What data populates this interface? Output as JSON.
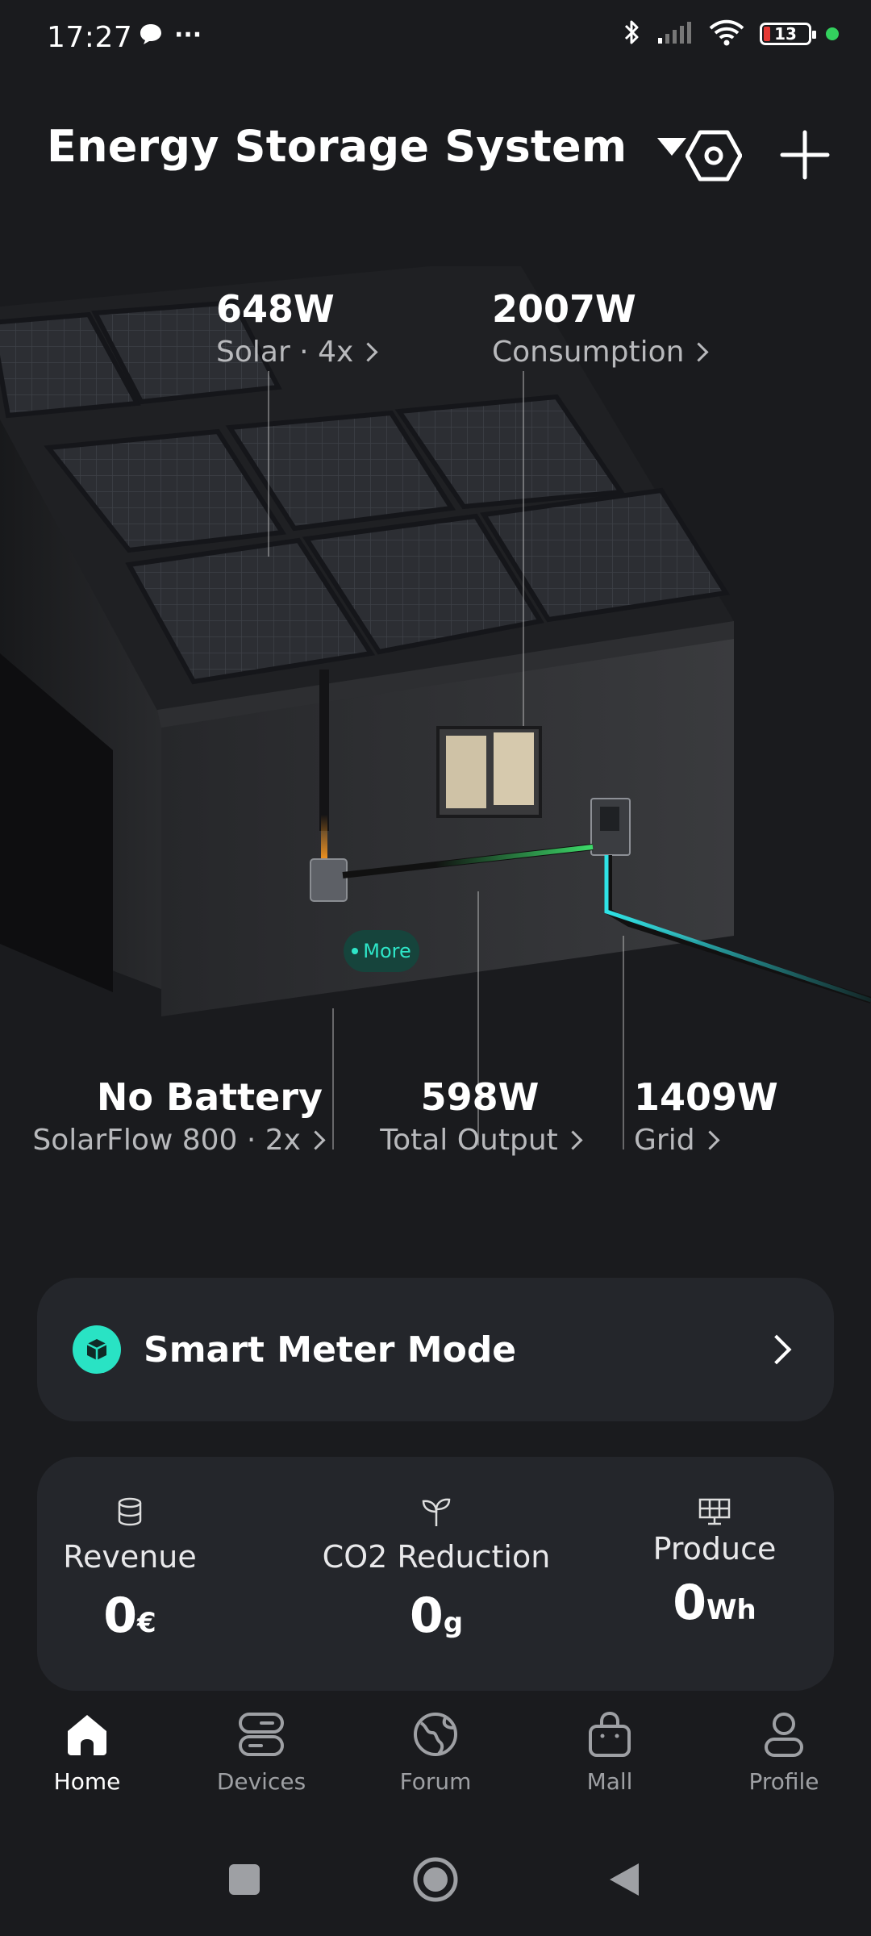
{
  "status_bar": {
    "time": "17:27",
    "more": "···",
    "battery_level": "13",
    "icons": [
      "chat-bubble-icon",
      "bluetooth-icon",
      "signal-icon",
      "wifi-icon",
      "battery-icon",
      "green-dot-icon"
    ]
  },
  "header": {
    "title": "Energy Storage System",
    "icons": [
      "dropdown-caret-icon",
      "hexagon-settings-icon",
      "plus-icon"
    ]
  },
  "energy_flow": {
    "solar": {
      "value": "648W",
      "label": "Solar · 4x"
    },
    "consumption": {
      "value": "2007W",
      "label": "Consumption"
    },
    "battery": {
      "value": "No Battery",
      "label": "SolarFlow 800 · 2x"
    },
    "total_output": {
      "value": "598W",
      "label": "Total Output"
    },
    "grid": {
      "value": "1409W",
      "label": "Grid"
    },
    "more_label": "More"
  },
  "smart_meter": {
    "label": "Smart Meter Mode",
    "icon": "cube-icon"
  },
  "stats": {
    "revenue": {
      "label": "Revenue",
      "value": "0",
      "unit": "€",
      "icon": "coins-icon"
    },
    "co2": {
      "label": "CO2 Reduction",
      "value": "0",
      "unit": "g",
      "icon": "sprout-icon"
    },
    "produce": {
      "label": "Produce",
      "value": "0",
      "unit": "Wh",
      "icon": "solar-panel-icon"
    }
  },
  "bottom_nav": [
    {
      "label": "Home",
      "icon": "home-icon",
      "active": true
    },
    {
      "label": "Devices",
      "icon": "devices-icon",
      "active": false
    },
    {
      "label": "Forum",
      "icon": "globe-icon",
      "active": false
    },
    {
      "label": "Mall",
      "icon": "bag-icon",
      "active": false
    },
    {
      "label": "Profile",
      "icon": "person-icon",
      "active": false
    }
  ],
  "colors": {
    "background": "#1a1b1e",
    "card": "#24262b",
    "accent_teal": "#29e3c4",
    "flow_green": "#3ddc6a",
    "flow_cyan": "#2fe3e6",
    "solar_orange": "#ff9a1e"
  }
}
